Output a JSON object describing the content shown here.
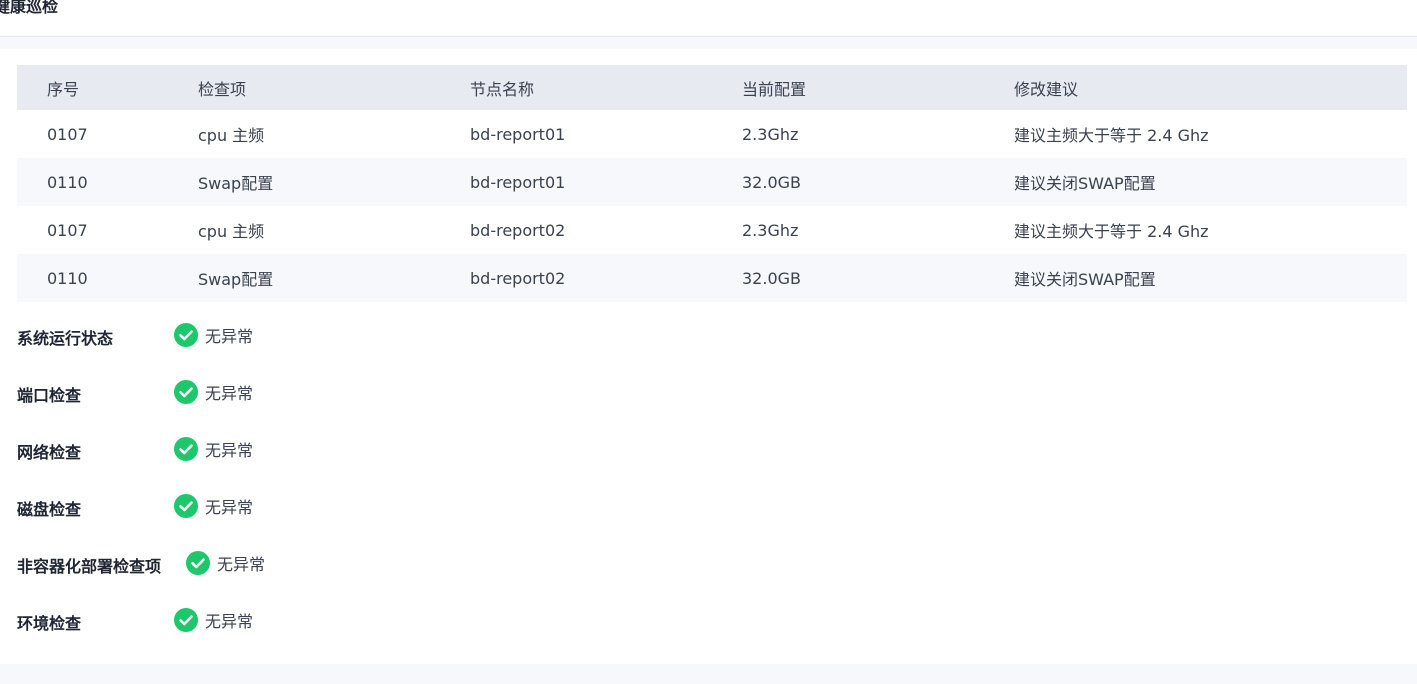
{
  "page": {
    "title": "健康巡检"
  },
  "table": {
    "headers": [
      "序号",
      "检查项",
      "节点名称",
      "当前配置",
      "修改建议"
    ],
    "rows": [
      [
        "0107",
        "cpu 主频",
        "bd-report01",
        "2.3Ghz",
        "建议主频大于等于 2.4 Ghz"
      ],
      [
        "0110",
        "Swap配置",
        "bd-report01",
        "32.0GB",
        "建议关闭SWAP配置"
      ],
      [
        "0107",
        "cpu 主频",
        "bd-report02",
        "2.3Ghz",
        "建议主频大于等于 2.4 Ghz"
      ],
      [
        "0110",
        "Swap配置",
        "bd-report02",
        "32.0GB",
        "建议关闭SWAP配置"
      ]
    ]
  },
  "checks": [
    {
      "label": "系统运行状态",
      "status": "无异常",
      "icon": "check-circle-icon"
    },
    {
      "label": "端口检查",
      "status": "无异常",
      "icon": "check-circle-icon"
    },
    {
      "label": "网络检查",
      "status": "无异常",
      "icon": "check-circle-icon"
    },
    {
      "label": "磁盘检查",
      "status": "无异常",
      "icon": "check-circle-icon"
    },
    {
      "label": "非容器化部署检查项",
      "status": "无异常",
      "icon": "check-circle-icon"
    },
    {
      "label": "环境检查",
      "status": "无异常",
      "icon": "check-circle-icon"
    }
  ],
  "colors": {
    "success": "#1ec76a",
    "header_bg": "#e7eaf0",
    "stripe_bg": "#f7f8fb"
  }
}
